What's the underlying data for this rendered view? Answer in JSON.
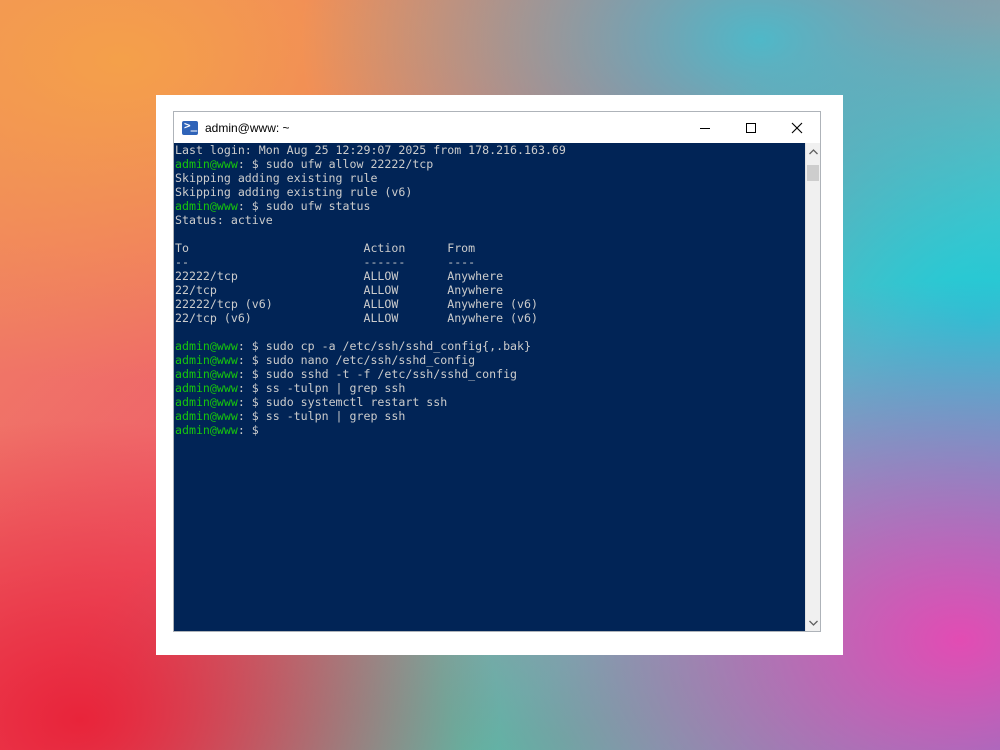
{
  "window": {
    "title": "admin@www: ~",
    "app_icon": "powershell-icon"
  },
  "controls": [
    {
      "name": "minimize-button",
      "icon": "minimize-icon"
    },
    {
      "name": "maximize-button",
      "icon": "maximize-icon"
    },
    {
      "name": "close-button",
      "icon": "close-icon"
    }
  ],
  "colors": {
    "terminal_bg": "#012456",
    "terminal_fg": "#cccccc",
    "prompt_user": "#16c60c"
  },
  "terminal": {
    "lines": [
      {
        "prompt": "",
        "text": "Last login: Mon Aug 25 12:29:07 2025 from 178.216.163.69"
      },
      {
        "prompt": "admin@www",
        "text": ": $ sudo ufw allow 22222/tcp"
      },
      {
        "prompt": "",
        "text": "Skipping adding existing rule"
      },
      {
        "prompt": "",
        "text": "Skipping adding existing rule (v6)"
      },
      {
        "prompt": "admin@www",
        "text": ": $ sudo ufw status"
      },
      {
        "prompt": "",
        "text": "Status: active"
      },
      {
        "prompt": "",
        "text": ""
      },
      {
        "prompt": "",
        "text": "To                         Action      From"
      },
      {
        "prompt": "",
        "text": "--                         ------      ----"
      },
      {
        "prompt": "",
        "text": "22222/tcp                  ALLOW       Anywhere"
      },
      {
        "prompt": "",
        "text": "22/tcp                     ALLOW       Anywhere"
      },
      {
        "prompt": "",
        "text": "22222/tcp (v6)             ALLOW       Anywhere (v6)"
      },
      {
        "prompt": "",
        "text": "22/tcp (v6)                ALLOW       Anywhere (v6)"
      },
      {
        "prompt": "",
        "text": ""
      },
      {
        "prompt": "admin@www",
        "text": ": $ sudo cp -a /etc/ssh/sshd_config{,.bak}"
      },
      {
        "prompt": "admin@www",
        "text": ": $ sudo nano /etc/ssh/sshd_config"
      },
      {
        "prompt": "admin@www",
        "text": ": $ sudo sshd -t -f /etc/ssh/sshd_config"
      },
      {
        "prompt": "admin@www",
        "text": ": $ ss -tulpn | grep ssh"
      },
      {
        "prompt": "admin@www",
        "text": ": $ sudo systemctl restart ssh"
      },
      {
        "prompt": "admin@www",
        "text": ": $ ss -tulpn | grep ssh"
      },
      {
        "prompt": "admin@www",
        "text": ": $ "
      }
    ]
  }
}
